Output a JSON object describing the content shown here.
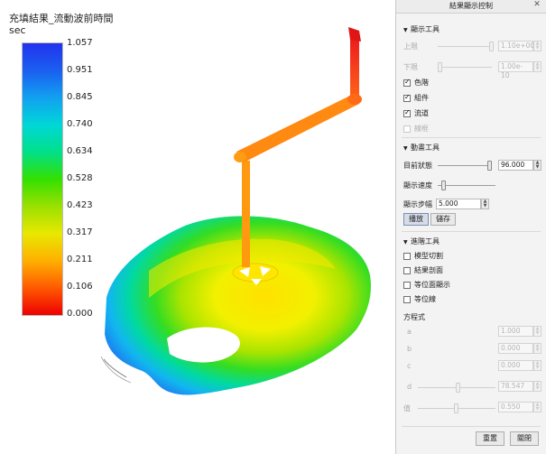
{
  "legend": {
    "title": "充填結果_流動波前時間",
    "unit": "sec",
    "ticks": [
      "1.057",
      "0.951",
      "0.845",
      "0.740",
      "0.634",
      "0.528",
      "0.423",
      "0.317",
      "0.211",
      "0.106",
      "0.000"
    ]
  },
  "panel": {
    "title": "結果顯示控制",
    "display_tools": {
      "header": "顯示工具",
      "upper_label": "上限",
      "upper_value": "1.10e+00",
      "lower_label": "下限",
      "lower_value": "1.00e-10",
      "checkboxes": [
        {
          "label": "色階",
          "checked": true,
          "disabled": false
        },
        {
          "label": "組件",
          "checked": true,
          "disabled": false
        },
        {
          "label": "流道",
          "checked": true,
          "disabled": false
        },
        {
          "label": "線框",
          "checked": false,
          "disabled": true
        }
      ]
    },
    "animation_tools": {
      "header": "動畫工具",
      "state_label": "目前狀態",
      "state_value": "96.000",
      "speed_label": "顯示速度",
      "step_label": "顯示步幅",
      "step_value": "5.000",
      "play_label": "播放",
      "save_label": "儲存"
    },
    "advanced_tools": {
      "header": "進階工具",
      "checkboxes": [
        {
          "label": "模型切割",
          "checked": false
        },
        {
          "label": "結果剖面",
          "checked": false
        },
        {
          "label": "等位面顯示",
          "checked": false
        },
        {
          "label": "等位線",
          "checked": false
        }
      ]
    },
    "equation": {
      "header": "方程式",
      "rows": [
        {
          "label": "a",
          "value": "1.000"
        },
        {
          "label": "b",
          "value": "0.000"
        },
        {
          "label": "c",
          "value": "0.000"
        },
        {
          "label": "d",
          "value": "78.547"
        },
        {
          "label": "值",
          "value": "0.550"
        }
      ]
    },
    "reset_label": "重置",
    "close_label": "關閉"
  }
}
